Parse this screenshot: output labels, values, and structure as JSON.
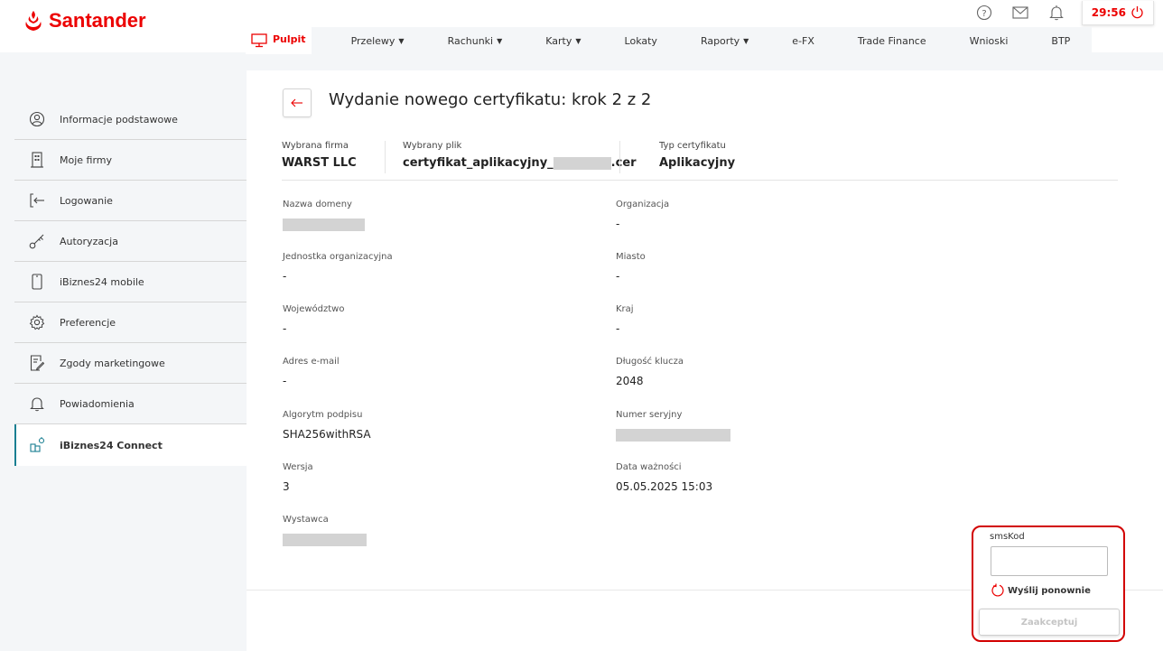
{
  "brand": {
    "name": "Santander",
    "color": "#ec0000"
  },
  "header": {
    "timer": "29:56",
    "icons": [
      "help-icon",
      "mail-icon",
      "bell-icon",
      "power-icon"
    ]
  },
  "nav": {
    "items": [
      {
        "label": "Pulpit",
        "active": true
      },
      {
        "label": "Przelewy",
        "dropdown": true
      },
      {
        "label": "Rachunki",
        "dropdown": true
      },
      {
        "label": "Karty",
        "dropdown": true
      },
      {
        "label": "Lokaty"
      },
      {
        "label": "Raporty",
        "dropdown": true
      },
      {
        "label": "e-FX"
      },
      {
        "label": "Trade Finance"
      },
      {
        "label": "Wnioski"
      },
      {
        "label": "BTP"
      }
    ]
  },
  "sidebar": {
    "items": [
      {
        "label": "Informacje podstawowe",
        "icon": "user-icon"
      },
      {
        "label": "Moje firmy",
        "icon": "building-icon"
      },
      {
        "label": "Logowanie",
        "icon": "login-icon"
      },
      {
        "label": "Autoryzacja",
        "icon": "key-icon"
      },
      {
        "label": "iBiznes24 mobile",
        "icon": "phone-icon"
      },
      {
        "label": "Preferencje",
        "icon": "gear-icon"
      },
      {
        "label": "Zgody marketingowe",
        "icon": "document-pen-icon"
      },
      {
        "label": "Powiadomienia",
        "icon": "bell-icon"
      },
      {
        "label": "iBiznes24 Connect",
        "icon": "connect-icon",
        "active": true
      }
    ]
  },
  "page": {
    "title": "Wydanie nowego certyfikatu: krok 2 z 2",
    "summary": {
      "company_label": "Wybrana firma",
      "company_value": "WARST LLC",
      "file_label": "Wybrany plik",
      "file_prefix": "certyfikat_aplikacyjny_",
      "file_suffix": ".cer",
      "type_label": "Typ certyfikatu",
      "type_value": "Aplikacyjny"
    },
    "fields": {
      "domain_label": "Nazwa domeny",
      "organization_label": "Organizacja",
      "organization_value": "-",
      "unit_label": "Jednostka organizacyjna",
      "unit_value": "-",
      "city_label": "Miasto",
      "city_value": "-",
      "voivodeship_label": "Województwo",
      "voivodeship_value": "-",
      "country_label": "Kraj",
      "country_value": "-",
      "email_label": "Adres e-mail",
      "email_value": "-",
      "key_length_label": "Długość klucza",
      "key_length_value": "2048",
      "algorithm_label": "Algorytm podpisu",
      "algorithm_value": "SHA256withRSA",
      "serial_label": "Numer seryjny",
      "version_label": "Wersja",
      "version_value": "3",
      "expiry_label": "Data ważności",
      "expiry_value": "05.05.2025 15:03",
      "issuer_label": "Wystawca"
    }
  },
  "sms": {
    "label": "smsKod",
    "value": "",
    "resend_label": "Wyślij ponownie",
    "accept_label": "Zaakceptuj"
  },
  "colors": {
    "accent": "#ec0000",
    "active_border": "#1a7f92",
    "highlight": "#d20000"
  }
}
